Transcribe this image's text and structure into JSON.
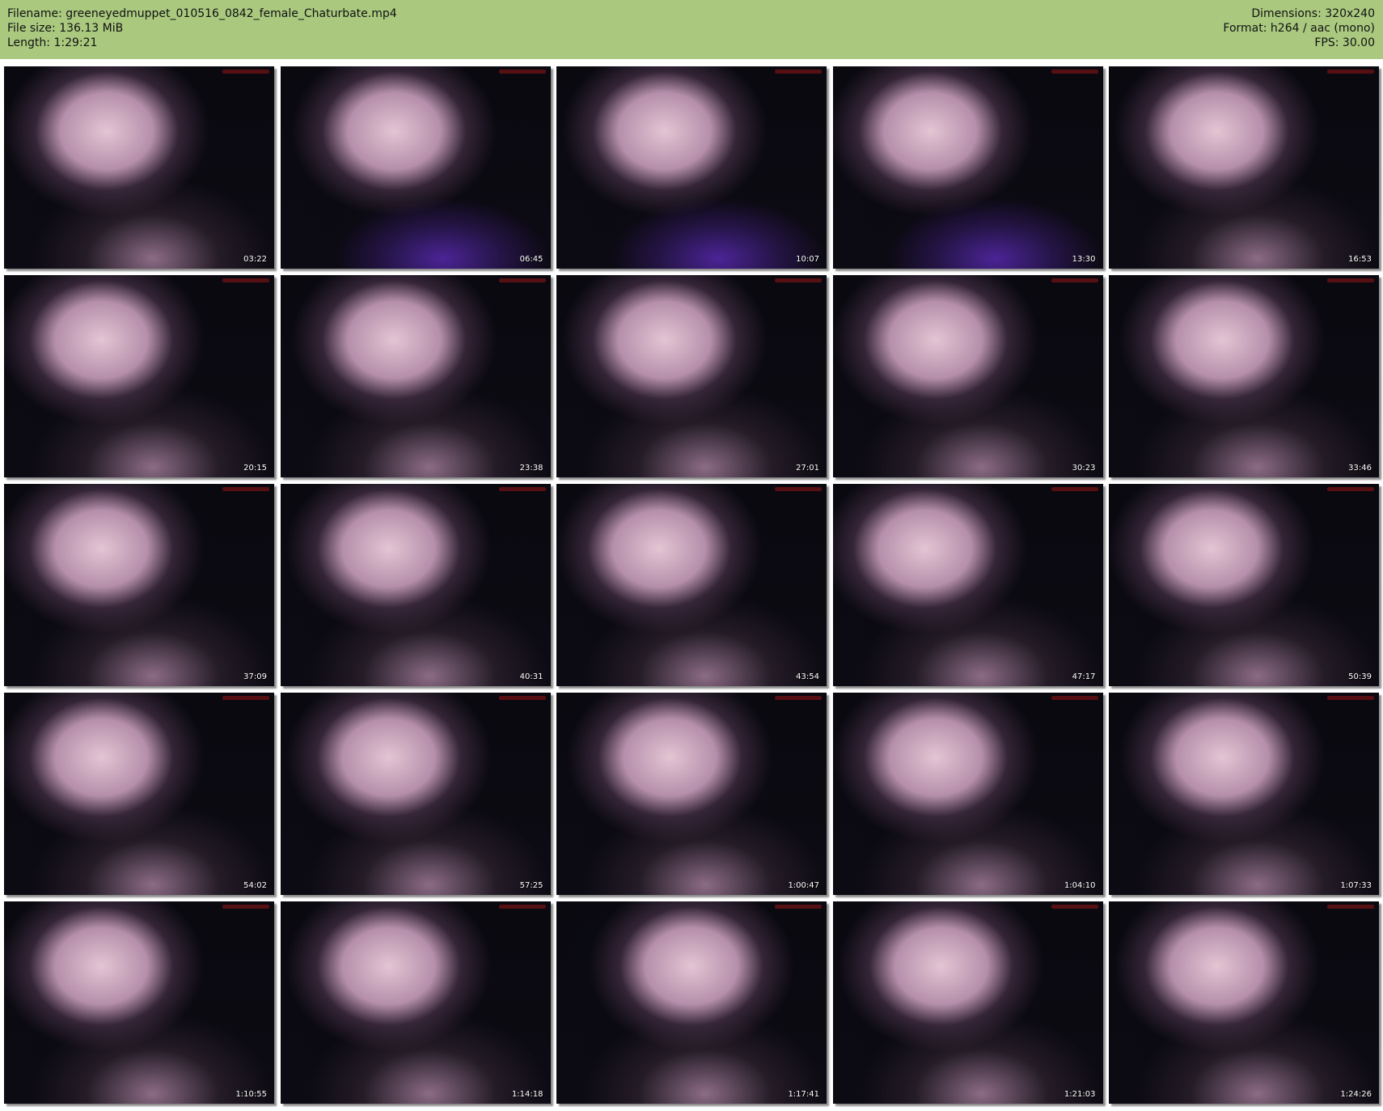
{
  "header": {
    "filename_line": "Filename: greeneyedmuppet_010516_0842_female_Chaturbate.mp4",
    "filesize_line": "File size: 136.13 MiB",
    "length_line": "Length: 1:29:21",
    "dimensions_line": "Dimensions: 320x240",
    "format_line": "Format: h264 / aac (mono)",
    "fps_line": "FPS: 30.00",
    "background_color": "#aac97f"
  },
  "thumbnails": [
    {
      "timestamp": "03:22"
    },
    {
      "timestamp": "06:45"
    },
    {
      "timestamp": "10:07"
    },
    {
      "timestamp": "13:30"
    },
    {
      "timestamp": "16:53"
    },
    {
      "timestamp": "20:15"
    },
    {
      "timestamp": "23:38"
    },
    {
      "timestamp": "27:01"
    },
    {
      "timestamp": "30:23"
    },
    {
      "timestamp": "33:46"
    },
    {
      "timestamp": "37:09"
    },
    {
      "timestamp": "40:31"
    },
    {
      "timestamp": "43:54"
    },
    {
      "timestamp": "47:17"
    },
    {
      "timestamp": "50:39"
    },
    {
      "timestamp": "54:02"
    },
    {
      "timestamp": "57:25"
    },
    {
      "timestamp": "1:00:47"
    },
    {
      "timestamp": "1:04:10"
    },
    {
      "timestamp": "1:07:33"
    },
    {
      "timestamp": "1:10:55"
    },
    {
      "timestamp": "1:14:18"
    },
    {
      "timestamp": "1:17:41"
    },
    {
      "timestamp": "1:21:03"
    },
    {
      "timestamp": "1:24:26"
    }
  ]
}
